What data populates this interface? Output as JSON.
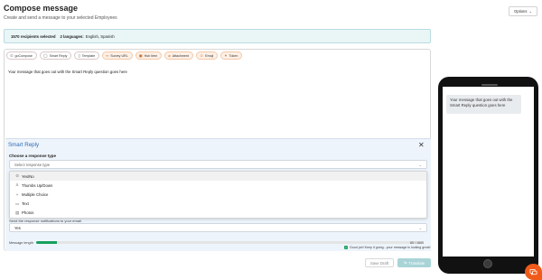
{
  "header": {
    "title": "Compose message",
    "subtitle": "Create and send a message to your selected Employees",
    "options_label": "Options",
    "options_chevron": "⌄"
  },
  "recipients": {
    "count_text": "1570 recipients selected",
    "languages_label": "2 languages:",
    "languages_value": "English, Spanish"
  },
  "toolbar": {
    "items": [
      {
        "label": "goCompose",
        "icon": "⊙",
        "style": "plain"
      },
      {
        "label": "Smart Reply",
        "icon": "◯",
        "style": "plain"
      },
      {
        "label": "Template",
        "icon": "▯",
        "style": "plain"
      },
      {
        "label": "Survey URL",
        "icon": "∞",
        "style": "orange"
      },
      {
        "label": "Hub Item",
        "icon": "▣",
        "style": "orange"
      },
      {
        "label": "Attachment",
        "icon": "⌀",
        "style": "orange"
      },
      {
        "label": "Emoji",
        "icon": "☺",
        "style": "orange"
      },
      {
        "label": "Token",
        "icon": "⚭",
        "style": "orange"
      }
    ]
  },
  "message": {
    "body": "Your message that goes out with the Smart Reply question goes here"
  },
  "smart_reply": {
    "title": "Smart Reply",
    "close_icon": "✕",
    "choose_label": "Choose a response type",
    "select_placeholder": "Select response type",
    "options": [
      {
        "label": "Yes/No",
        "icon": "⊙",
        "selected": true
      },
      {
        "label": "Thumbs Up/Down",
        "icon": "♙",
        "selected": false
      },
      {
        "label": "Multiple Choice",
        "icon": "+",
        "selected": false
      },
      {
        "label": "Text",
        "icon": "▭",
        "selected": false
      },
      {
        "label": "Photos",
        "icon": "▤",
        "selected": false
      }
    ],
    "partial_label": "Send the response notifications to your email",
    "secondary_value": "Yes"
  },
  "message_length": {
    "label": "Message length",
    "count": "85 / 1600",
    "percent": 5.3,
    "good_note": "Good job! Keep it going - your message is looking great!"
  },
  "actions": {
    "save_draft": "Save Draft",
    "translate": "Translate"
  },
  "preview": {
    "bubble_text": "Your message that goes out with the Smart Reply question goes here"
  },
  "colors": {
    "accent": "#2e6bb5",
    "success": "#17a05d",
    "brand_orange": "#f05a1a"
  }
}
